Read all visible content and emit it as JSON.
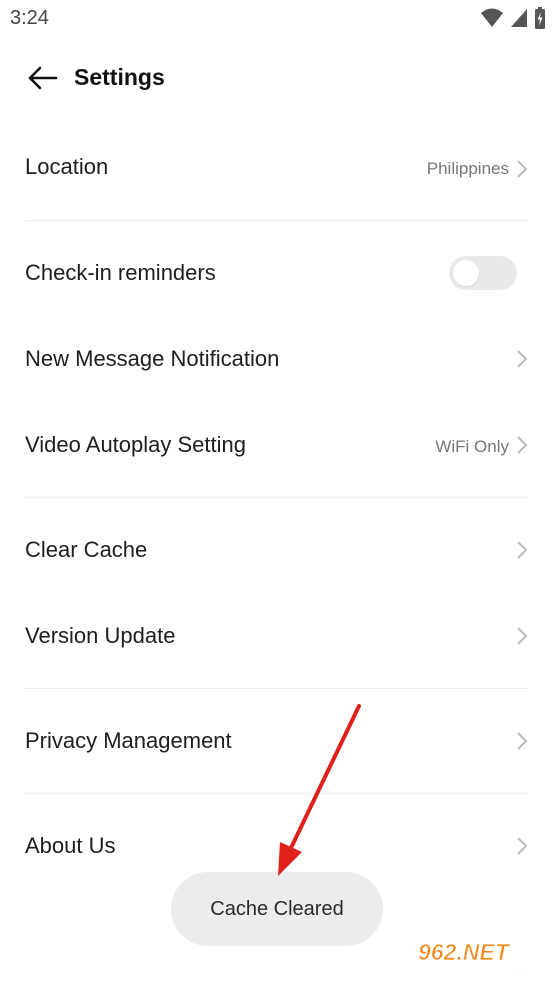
{
  "status_bar": {
    "time": "3:24"
  },
  "header": {
    "title": "Settings"
  },
  "settings": {
    "location": {
      "label": "Location",
      "value": "Philippines"
    },
    "checkin": {
      "label": "Check-in reminders",
      "enabled": false
    },
    "new_message": {
      "label": "New Message Notification"
    },
    "video_autoplay": {
      "label": "Video Autoplay Setting",
      "value": "WiFi Only"
    },
    "clear_cache": {
      "label": "Clear Cache"
    },
    "version_update": {
      "label": "Version Update"
    },
    "privacy": {
      "label": "Privacy Management"
    },
    "about": {
      "label": "About Us"
    }
  },
  "toast": {
    "text": "Cache Cleared"
  },
  "watermark": {
    "text": "962.NET",
    "subtext": "乐游网"
  },
  "colors": {
    "annotation_arrow": "#e0201b",
    "watermark_orange": "#f08a1c"
  }
}
